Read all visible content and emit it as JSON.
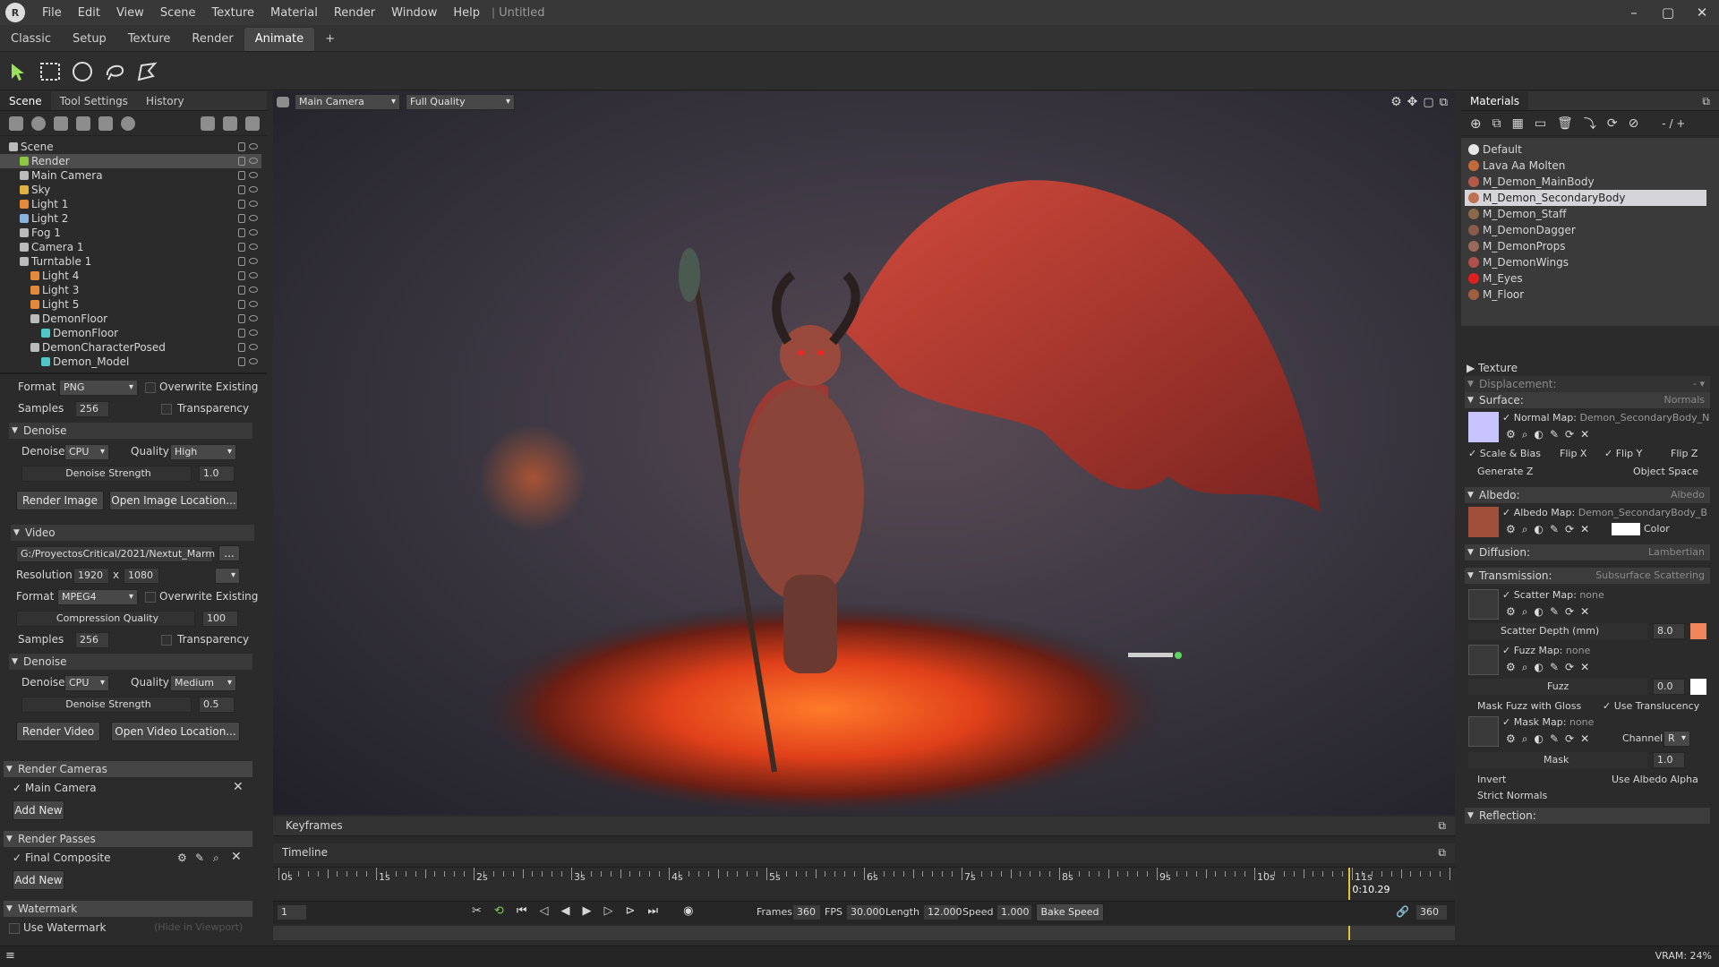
{
  "titlebar": {
    "menus": [
      "File",
      "Edit",
      "View",
      "Scene",
      "Texture",
      "Material",
      "Render",
      "Window",
      "Help"
    ],
    "document": "Untitled",
    "logo": "RRCG"
  },
  "tabs": [
    "Classic",
    "Setup",
    "Texture",
    "Render",
    "Animate",
    "+"
  ],
  "left": {
    "tabs": [
      "Scene",
      "Tool Settings",
      "History"
    ],
    "tree": [
      {
        "label": "Scene",
        "depth": 0,
        "color": "#bbbbbb"
      },
      {
        "label": "Render",
        "depth": 1,
        "color": "#8dc63f",
        "selected": true
      },
      {
        "label": "Main Camera",
        "depth": 1,
        "color": "#bbbbbb"
      },
      {
        "label": "Sky",
        "depth": 1,
        "color": "#e0b040"
      },
      {
        "label": "Light 1",
        "depth": 1,
        "color": "#e08a3a"
      },
      {
        "label": "Light 2",
        "depth": 1,
        "color": "#8ab4e0"
      },
      {
        "label": "Fog 1",
        "depth": 1,
        "color": "#bbbbbb"
      },
      {
        "label": "Camera 1",
        "depth": 1,
        "color": "#bbbbbb"
      },
      {
        "label": "Turntable 1",
        "depth": 1,
        "color": "#bbbbbb"
      },
      {
        "label": "Light 4",
        "depth": 2,
        "color": "#e08a3a"
      },
      {
        "label": "Light 3",
        "depth": 2,
        "color": "#e08a3a"
      },
      {
        "label": "Light 5",
        "depth": 2,
        "color": "#e08a3a"
      },
      {
        "label": "DemonFloor",
        "depth": 2,
        "color": "#bbbbbb"
      },
      {
        "label": "DemonFloor",
        "depth": 3,
        "color": "#4fc7c7"
      },
      {
        "label": "DemonCharacterPosed",
        "depth": 2,
        "color": "#bbbbbb"
      },
      {
        "label": "Demon_Model",
        "depth": 3,
        "color": "#4fc7c7"
      }
    ],
    "image": {
      "format_label": "Format",
      "format": "PNG",
      "overwrite": "Overwrite Existing",
      "samples_label": "Samples",
      "samples": "256",
      "transparency": "Transparency",
      "denoise_section": "Denoise",
      "denoise_label": "Denoise",
      "denoise": "CPU",
      "quality_label": "Quality",
      "quality": "High",
      "strength_label": "Denoise Strength",
      "strength": "1.0",
      "render_btn": "Render Image",
      "open_btn": "Open Image Location..."
    },
    "video": {
      "section": "Video",
      "path": "G:/ProyectosCritical/2021/Nextut_Marm",
      "browse": "...",
      "res_label": "Resolution:",
      "res_w": "1920",
      "res_x": "x",
      "res_h": "1080",
      "format_label": "Format",
      "format": "MPEG4",
      "overwrite": "Overwrite Existing",
      "compression_label": "Compression Quality",
      "compression": "100",
      "samples_label": "Samples",
      "samples": "256",
      "transparency": "Transparency",
      "denoise_section": "Denoise",
      "denoise_label": "Denoise",
      "denoise": "CPU",
      "quality_label": "Quality",
      "quality": "Medium",
      "strength_label": "Denoise Strength",
      "strength": "0.5",
      "render_btn": "Render Video",
      "open_btn": "Open Video Location..."
    },
    "cameras": {
      "section": "Render Cameras",
      "item": "Main Camera",
      "add": "Add New"
    },
    "passes": {
      "section": "Render Passes",
      "item": "Final Composite",
      "add": "Add New"
    },
    "watermark": {
      "section": "Watermark",
      "item": "Use Watermark",
      "hint": "(Hide in Viewport)"
    }
  },
  "viewport": {
    "camera": "Main Camera",
    "quality": "Full Quality"
  },
  "timeline": {
    "keyframes_tab": "Keyframes",
    "timeline_tab": "Timeline",
    "ticks": [
      "0s",
      "1s",
      "2s",
      "3s",
      "4s",
      "5s",
      "6s",
      "7s",
      "8s",
      "9s",
      "10s",
      "11s"
    ],
    "current_time": "0:10.29",
    "frame": "1",
    "frames_label": "Frames",
    "frames": "360",
    "fps_label": "FPS",
    "fps": "30.000",
    "length_label": "Length",
    "length": "12.000",
    "speed_label": "Speed",
    "speed": "1.000",
    "bake": "Bake Speed",
    "end_frame": "360"
  },
  "right": {
    "tab": "Materials",
    "materials": [
      {
        "label": "Default",
        "color": "#e8e8e8"
      },
      {
        "label": "Lava Aa Molten",
        "color": "#c46a3a"
      },
      {
        "label": "M_Demon_MainBody",
        "color": "#b45a4a"
      },
      {
        "label": "M_Demon_SecondaryBody",
        "color": "#c07055",
        "selected": true
      },
      {
        "label": "M_Demon_Staff",
        "color": "#8a6a4a"
      },
      {
        "label": "M_DemonDagger",
        "color": "#8a5a4a"
      },
      {
        "label": "M_DemonProps",
        "color": "#9a6a5a"
      },
      {
        "label": "M_DemonWings",
        "color": "#b0504a"
      },
      {
        "label": "M_Eyes",
        "color": "#e02020"
      },
      {
        "label": "M_Floor",
        "color": "#a06040"
      }
    ],
    "texture_section": "Texture",
    "displacement": "Displacement:",
    "surface": {
      "label": "Surface:",
      "value": "Normals",
      "map": "Normal Map:",
      "map_name": "Demon_SecondaryBody_N",
      "scale_bias": "Scale & Bias",
      "flipx": "Flip X",
      "flipy": "Flip Y",
      "flipz": "Flip Z",
      "generate_z": "Generate Z",
      "object_space": "Object Space"
    },
    "albedo": {
      "label": "Albedo:",
      "value": "Albedo",
      "map": "Albedo Map:",
      "map_name": "Demon_SecondaryBody_B",
      "color": "Color"
    },
    "diffusion": {
      "label": "Diffusion:",
      "value": "Lambertian"
    },
    "transmission": {
      "label": "Transmission:",
      "value": "Subsurface Scattering",
      "scatter_map": "Scatter Map:",
      "scatter_none": "none",
      "scatter_depth": "Scatter Depth (mm)",
      "scatter_depth_val": "8.0",
      "fuzz_map": "Fuzz Map:",
      "fuzz_none": "none",
      "fuzz": "Fuzz",
      "fuzz_val": "0.0",
      "mask_fuzz": "Mask Fuzz with Gloss",
      "use_translucency": "Use Translucency",
      "mask_map": "Mask Map:",
      "mask_none": "none",
      "channel": "Channel",
      "channel_val": "R",
      "mask": "Mask",
      "mask_val": "1.0",
      "invert": "Invert",
      "use_albedo_alpha": "Use Albedo Alpha",
      "strict_normals": "Strict Normals"
    },
    "reflection": {
      "label": "Reflection:"
    }
  },
  "status": {
    "vram": "VRAM: 24%"
  },
  "colors": {
    "accent_sel": "#d5d5d9",
    "viewport_bg": "#3f3a45",
    "lava": "#ff5a1a"
  }
}
